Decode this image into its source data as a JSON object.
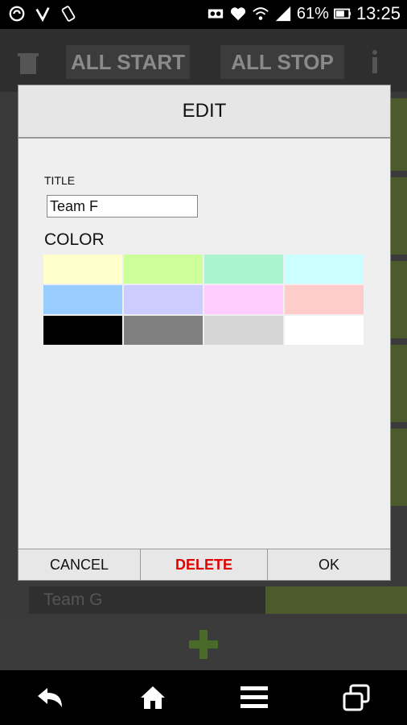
{
  "status": {
    "battery": "61%",
    "time": "13:25"
  },
  "toolbar": {
    "all_start": "ALL START",
    "all_stop": "ALL STOP"
  },
  "background_row": {
    "label": "Team G"
  },
  "dialog": {
    "title": "EDIT",
    "title_label": "TITLE",
    "title_value": "Team F",
    "color_label": "COLOR",
    "cancel": "CANCEL",
    "delete": "DELETE",
    "ok": "OK"
  },
  "palette": [
    "#ffffcc",
    "#ccff99",
    "#aaf5cf",
    "#ccffff",
    "#99ccff",
    "#ccccff",
    "#ffccff",
    "#ffcccc",
    "#000000",
    "#808080",
    "#d6d6d6",
    "#ffffff"
  ],
  "icons": {
    "statusbar_left": [
      "sync-icon",
      "nfc-icon",
      "rotate-icon"
    ],
    "statusbar_right": [
      "voicemail-icon",
      "heart-icon",
      "wifi-icon",
      "signal-icon",
      "battery-icon"
    ],
    "toolbar": [
      "trash-icon",
      "info-icon"
    ],
    "add": "add-icon",
    "nav": [
      "back-icon",
      "home-icon",
      "menu-icon",
      "recent-apps-icon"
    ]
  },
  "colors": {
    "accent_add": "#4a6a2a",
    "delete_text": "#e00000"
  }
}
